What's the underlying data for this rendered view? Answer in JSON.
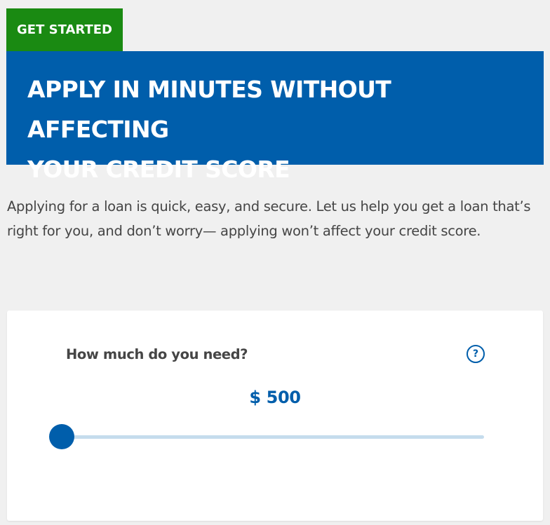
{
  "header": {
    "badge_label": "GET STARTED",
    "title": "APPLY IN MINUTES WITHOUT AFFECTING\nYOUR CREDIT SCORE"
  },
  "intro": {
    "text": "Applying for a loan is quick, easy, and secure. Let us help you get a loan that’s right for you, and don’t worry— applying won’t affect your credit score."
  },
  "loan_card": {
    "question": "How much do you need?",
    "help_icon": "question-circle-icon",
    "help_glyph": "?",
    "amount_display": "$ 500",
    "slider": {
      "value_fraction": 0.0
    }
  },
  "colors": {
    "badge_green": "#1a8a12",
    "brand_blue": "#005eab",
    "track_light_blue": "#c5dced",
    "page_background": "#f0f0f0",
    "body_text": "#454545"
  }
}
